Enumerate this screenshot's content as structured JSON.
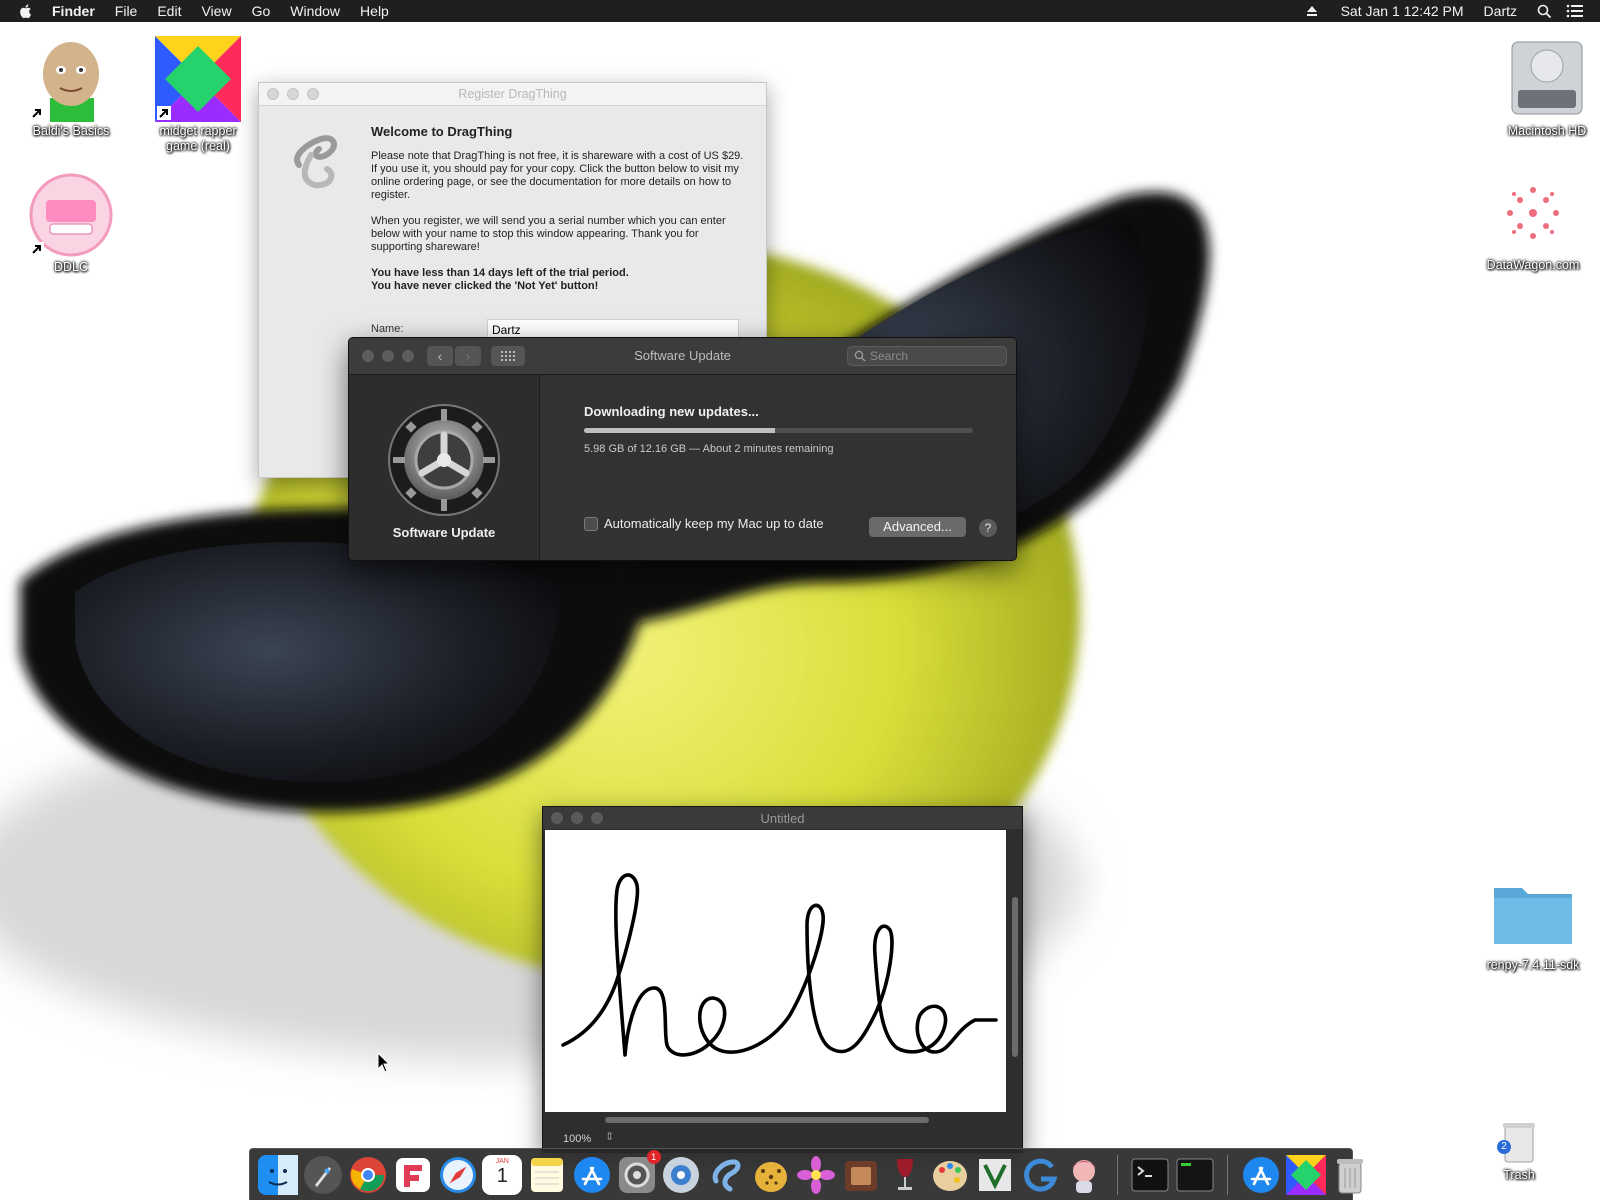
{
  "menubar": {
    "app_name": "Finder",
    "menus": [
      "File",
      "Edit",
      "View",
      "Go",
      "Window",
      "Help"
    ],
    "clock": "Sat Jan 1  12:42 PM",
    "user": "Dartz"
  },
  "desktop_icons": {
    "baldi": "Baldi's Basics",
    "midget": "midget rapper game (real)",
    "ddlc": "DDLC",
    "macintosh_hd": "Macintosh HD",
    "datawagon": "DataWagon.com",
    "renpy": "renpy-7.4.11-sdk",
    "trash": "Trash",
    "trash_badge": "2"
  },
  "register_window": {
    "title": "Register DragThing",
    "heading": "Welcome to DragThing",
    "para1": "Please note that DragThing is not free, it is shareware with a cost of US $29. If you use it, you should pay for your copy. Click the button below to visit my online ordering page, or see the documentation for more details on how to register.",
    "para2": "When you register, we will send you a serial number which you can enter below with your name to stop this window appearing. Thank you for supporting shareware!",
    "warn1": "You have less than 14 days left of the trial period.",
    "warn2": "You have never clicked the 'Not Yet' button!",
    "name_label": "Name:",
    "name_value": "Dartz"
  },
  "software_update": {
    "title": "Software Update",
    "search_placeholder": "Search",
    "pane_label": "Software Update",
    "status": "Downloading new updates...",
    "progress": 0.49,
    "detail": "5.98 GB of 12.16 GB — About 2 minutes remaining",
    "auto_label": "Automatically keep my Mac up to date",
    "advanced_label": "Advanced...",
    "help_label": "?"
  },
  "drawing_window": {
    "title": "Untitled",
    "handwriting": "hello",
    "zoom": "100%"
  },
  "dock": {
    "items": [
      "Finder",
      "Launchpad",
      "Chrome",
      "Flashcard",
      "Safari",
      "Calendar",
      "Notes",
      "App Store",
      "System Preferences",
      "Migration",
      "DragThing",
      "Cheetah",
      "Flower",
      "Photo Booth",
      "Wine",
      "Paint",
      "Vim",
      "G App",
      "Anime",
      "Terminal",
      "Console",
      "App Store 2",
      "Midget",
      "Trash"
    ],
    "calendar_month": "JAN",
    "calendar_day": "1",
    "sysprefs_badge": "1"
  },
  "colors": {
    "menubar_bg": "#1f1f1f",
    "dark_window_bg": "#323232",
    "apple_yellow": "#d9df3a"
  }
}
